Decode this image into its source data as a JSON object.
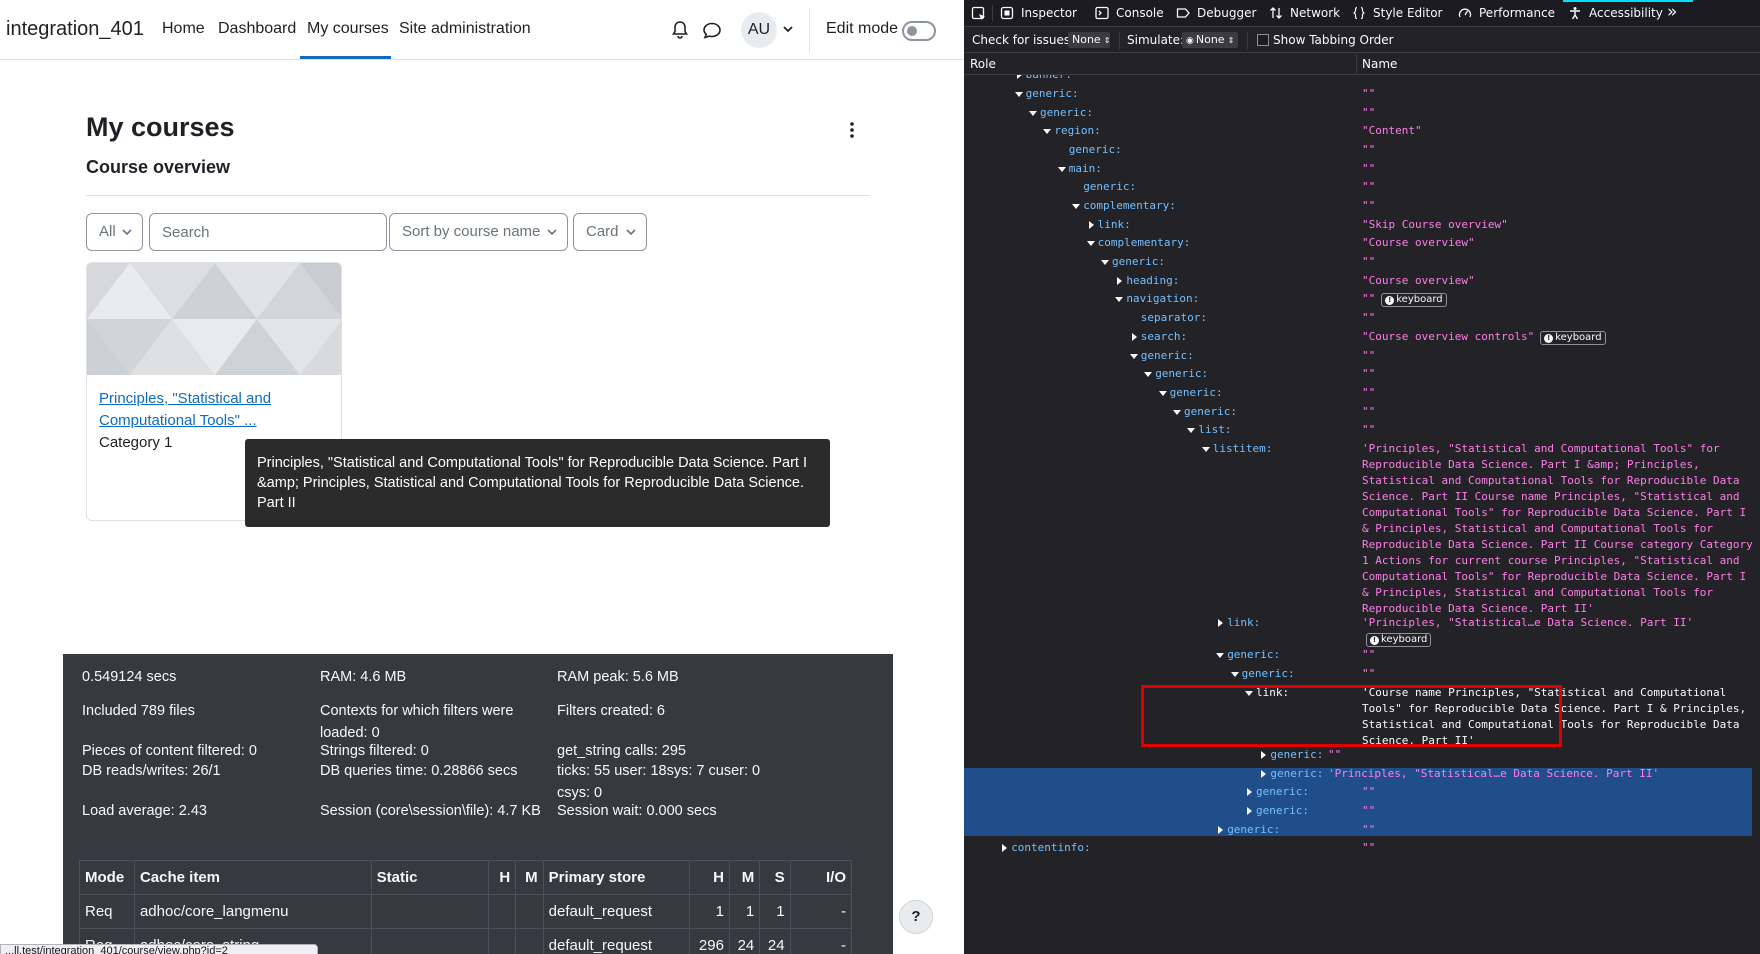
{
  "page": {
    "site_name": "integration_401",
    "nav": [
      "Home",
      "Dashboard",
      "My courses",
      "Site administration"
    ],
    "avatar": "AU",
    "edit_mode_label": "Edit mode",
    "title": "My courses",
    "section_title": "Course overview",
    "filter": {
      "grouping": "All",
      "search_placeholder": "Search",
      "sort": "Sort by course name",
      "view": "Card"
    },
    "course_card": {
      "link_text": "Principles, \"Statistical and Computational Tools\" ...",
      "category": "Category 1"
    },
    "tooltip": " Principles, \"Statistical and Computational Tools\" for Reproducible Data Science. Part I &amp; Principles, Statistical and Computational Tools for Reproducible Data Science. Part II",
    "perf": {
      "col1": [
        "0.549124 secs",
        "Included 789 files",
        "Pieces of content filtered: 0",
        "DB reads/writes: 26/1",
        "Load average: 2.43"
      ],
      "col2": [
        "RAM: 4.6 MB",
        "Contexts for which filters were loaded: 0",
        "Strings filtered: 0",
        "DB queries time: 0.28866 secs",
        "Session (core\\session\\file): 4.7 KB"
      ],
      "col3": [
        "RAM peak: 5.6 MB",
        "Filters created: 6",
        "get_string calls: 295",
        "ticks: 55 user: 18sys: 7 cuser: 0 csys: 0",
        "Session wait: 0.000 secs"
      ]
    },
    "cache_table": {
      "headers": [
        "Mode",
        "Cache item",
        "Static",
        "H",
        "M",
        "Primary store",
        "H",
        "M",
        "S",
        "I/O"
      ],
      "rows": [
        [
          "Req",
          "adhoc/core_langmenu",
          "",
          "",
          "",
          "default_request",
          "1",
          "1",
          "1",
          "-"
        ],
        [
          "Req",
          "adhoc/core_string",
          "",
          "",
          "",
          "default_request",
          "296",
          "24",
          "24",
          "-"
        ]
      ]
    },
    "help_label": "?",
    "status_url": "...ll.test/integration_401/course/view.php?id=2"
  },
  "devtools": {
    "tabs": [
      "Inspector",
      "Console",
      "Debugger",
      "Network",
      "Style Editor",
      "Performance",
      "Accessibility"
    ],
    "more": "»",
    "check_label": "Check for issues:",
    "check_value": "None",
    "simulate_label": "Simulate:",
    "simulate_value": "None",
    "tabbing_label": "Show Tabbing Order",
    "col_role": "Role",
    "col_name": "Name",
    "keyboard_badge": "keyboard",
    "tree": [
      {
        "depth": 4,
        "open": false,
        "role": "banner:",
        "name": "\"\""
      },
      {
        "depth": 4,
        "open": true,
        "role": "generic:",
        "name": "\"\""
      },
      {
        "depth": 5,
        "open": true,
        "role": "generic:",
        "name": "\"\""
      },
      {
        "depth": 6,
        "open": true,
        "role": "region:",
        "name": "\"Content\""
      },
      {
        "depth": 7,
        "open": null,
        "role": "generic:",
        "name": "\"\""
      },
      {
        "depth": 7,
        "open": true,
        "role": "main:",
        "name": "\"\""
      },
      {
        "depth": 8,
        "open": null,
        "role": "generic:",
        "name": "\"\""
      },
      {
        "depth": 8,
        "open": true,
        "role": "complementary:",
        "name": "\"\""
      },
      {
        "depth": 9,
        "open": false,
        "role": "link:",
        "name": "\"Skip Course overview\""
      },
      {
        "depth": 9,
        "open": true,
        "role": "complementary:",
        "name": "\"Course overview\""
      },
      {
        "depth": 10,
        "open": true,
        "role": "generic:",
        "name": "\"\""
      },
      {
        "depth": 11,
        "open": false,
        "role": "heading:",
        "name": "\"Course overview\""
      },
      {
        "depth": 11,
        "open": true,
        "role": "navigation:",
        "name": "\"\"",
        "kbd": true
      },
      {
        "depth": 12,
        "open": null,
        "role": "separator:",
        "name": "\"\""
      },
      {
        "depth": 12,
        "open": false,
        "role": "search:",
        "name": "\"Course overview controls\"",
        "kbd": true
      },
      {
        "depth": 12,
        "open": true,
        "role": "generic:",
        "name": "\"\""
      },
      {
        "depth": 13,
        "open": true,
        "role": "generic:",
        "name": "\"\""
      },
      {
        "depth": 14,
        "open": true,
        "role": "generic:",
        "name": "\"\""
      },
      {
        "depth": 15,
        "open": true,
        "role": "generic:",
        "name": "\"\""
      },
      {
        "depth": 16,
        "open": true,
        "role": "list:",
        "name": "\"\""
      },
      {
        "depth": 17,
        "open": true,
        "role": "listitem:",
        "name": "'Principles, \"Statistical and Computational Tools\" for Reproducible Data Science. Part I &amp; Principles, Statistical and Computational Tools for Reproducible Data Science. Part II Course name Principles, \"Statistical and Computational Tools\" for Reproducible Data Science. Part I & Principles, Statistical and Computational Tools for Reproducible Data Science. Part II Course category Category 1 Actions for current course Principles, \"Statistical and Computational Tools\" for Reproducible Data Science. Part I & Principles, Statistical and Computational Tools for Reproducible Data Science. Part II'"
      },
      {
        "depth": 18,
        "open": false,
        "role": "link:",
        "name": "'Principles, \"Statistical…e Data Science. Part II'",
        "kbd_newline": true
      },
      {
        "depth": 18,
        "open": true,
        "role": "generic:",
        "name": "\"\""
      },
      {
        "depth": 19,
        "open": true,
        "role": "generic:",
        "name": "\"\""
      },
      {
        "depth": 20,
        "open": true,
        "role": "link:",
        "name": "'Course name Principles, \"Statistical and Computational Tools\" for Reproducible Data Science. Part I & Principles, Statistical and Computational Tools for Reproducible Data Science. Part II'",
        "selected": true
      },
      {
        "depth": 21,
        "open": false,
        "role": "generic:",
        "name": "\"\"",
        "inline": true
      },
      {
        "depth": 21,
        "open": false,
        "role": "generic:",
        "name": "'Principles, \"Statistical…e Data Science. Part II'",
        "inline": true
      },
      {
        "depth": 20,
        "open": false,
        "role": "generic:",
        "name": "\"\""
      },
      {
        "depth": 20,
        "open": false,
        "role": "generic:",
        "name": "\"\""
      },
      {
        "depth": 18,
        "open": false,
        "role": "generic:",
        "name": "\"\""
      },
      {
        "depth": 3,
        "open": false,
        "role": "contentinfo:",
        "name": "\"\""
      }
    ]
  }
}
